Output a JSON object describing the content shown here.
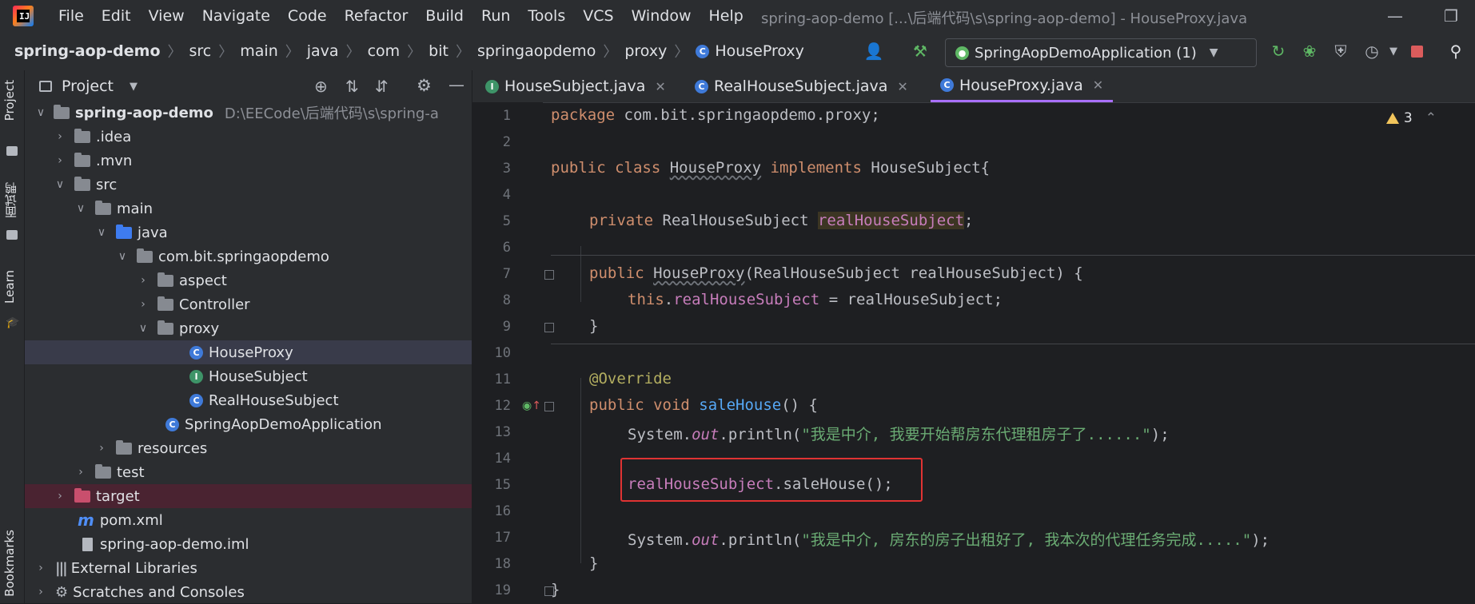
{
  "menu": {
    "items": [
      "File",
      "Edit",
      "View",
      "Navigate",
      "Code",
      "Refactor",
      "Build",
      "Run",
      "Tools",
      "VCS",
      "Window",
      "Help"
    ],
    "window_title": "spring-aop-demo [...\\后端代码\\s\\spring-aop-demo] - HouseProxy.java"
  },
  "breadcrumb": {
    "items": [
      "spring-aop-demo",
      "src",
      "main",
      "java",
      "com",
      "bit",
      "springaopdemo",
      "proxy",
      "HouseProxy"
    ]
  },
  "toolbar": {
    "run_config": "SpringAopDemoApplication (1)"
  },
  "left_strip": {
    "project": "Project",
    "interview": "面试鸭",
    "learn": "Learn",
    "bookmarks": "Bookmarks"
  },
  "project_panel": {
    "title": "Project",
    "tree": [
      {
        "label": "spring-aop-demo",
        "path": "D:\\EECode\\后端代码\\s\\spring-a",
        "icon": "module-folder",
        "level": 0,
        "open": true
      },
      {
        "label": ".idea",
        "icon": "folder",
        "level": 1,
        "open": false
      },
      {
        "label": ".mvn",
        "icon": "folder",
        "level": 1,
        "open": false
      },
      {
        "label": "src",
        "icon": "folder",
        "level": 1,
        "open": true
      },
      {
        "label": "main",
        "icon": "folder",
        "level": 2,
        "open": true
      },
      {
        "label": "java",
        "icon": "source-folder",
        "level": 3,
        "open": true
      },
      {
        "label": "com.bit.springaopdemo",
        "icon": "package",
        "level": 4,
        "open": true
      },
      {
        "label": "aspect",
        "icon": "package",
        "level": 5,
        "open": false
      },
      {
        "label": "Controller",
        "icon": "package",
        "level": 5,
        "open": false
      },
      {
        "label": "proxy",
        "icon": "package",
        "level": 5,
        "open": true
      },
      {
        "label": "HouseProxy",
        "icon": "class",
        "level": 6,
        "selected": true
      },
      {
        "label": "HouseSubject",
        "icon": "interface",
        "level": 6
      },
      {
        "label": "RealHouseSubject",
        "icon": "class",
        "level": 6
      },
      {
        "label": "SpringAopDemoApplication",
        "icon": "spring-class",
        "level": 5
      },
      {
        "label": "resources",
        "icon": "resources-folder",
        "level": 3,
        "open": false
      },
      {
        "label": "test",
        "icon": "folder",
        "level": 2,
        "open": false
      },
      {
        "label": "target",
        "icon": "excluded-folder",
        "level": 1,
        "open": false
      },
      {
        "label": "pom.xml",
        "icon": "maven-file",
        "level": 1
      },
      {
        "label": "spring-aop-demo.iml",
        "icon": "iml-file",
        "level": 1
      },
      {
        "label": "External Libraries",
        "icon": "libraries",
        "level": 0,
        "open": false
      },
      {
        "label": "Scratches and Consoles",
        "icon": "scratches",
        "level": 0,
        "open": false
      }
    ]
  },
  "editor": {
    "tabs": [
      {
        "label": "HouseSubject.java",
        "icon": "interface",
        "active": false
      },
      {
        "label": "RealHouseSubject.java",
        "icon": "class",
        "active": false
      },
      {
        "label": "HouseProxy.java",
        "icon": "class",
        "active": true
      }
    ],
    "warning_count": "3",
    "line_numbers": [
      "1",
      "2",
      "3",
      "4",
      "5",
      "6",
      "7",
      "8",
      "9",
      "10",
      "11",
      "12",
      "13",
      "14",
      "15",
      "16",
      "17",
      "18",
      "19"
    ],
    "code": {
      "l1_kw": "package",
      "l1_rest": " com.bit.springaopdemo.proxy;",
      "l3_kw": "public class ",
      "l3_cls": "HouseProxy",
      "l3_impl": " implements ",
      "l3_rest": "HouseSubject{",
      "l5_kw": "private ",
      "l5_type": "RealHouseSubject ",
      "l5_field": "realHouseSubject",
      "l5_end": ";",
      "l7_kw": "public ",
      "l7_cls": "HouseProxy",
      "l7_rest": "(RealHouseSubject realHouseSubject) {",
      "l8_this": "this",
      "l8_dot": ".",
      "l8_field": "realHouseSubject",
      "l8_rest": " = realHouseSubject;",
      "l9": "}",
      "l11": "@Override",
      "l12_kw": "public void ",
      "l12_fn": "saleHouse",
      "l12_rest": "() {",
      "l13_pre": "System.",
      "l13_out": "out",
      "l13_mid": ".println(",
      "l13_str": "\"我是中介, 我要开始帮房东代理租房子了......\"",
      "l13_end": ");",
      "l15_field": "realHouseSubject",
      "l15_rest": ".saleHouse();",
      "l17_pre": "System.",
      "l17_out": "out",
      "l17_mid": ".println(",
      "l17_str": "\"我是中介, 房东的房子出租好了, 我本次的代理任务完成.....\"",
      "l17_end": ");",
      "l18": "}",
      "l19": "}"
    }
  }
}
